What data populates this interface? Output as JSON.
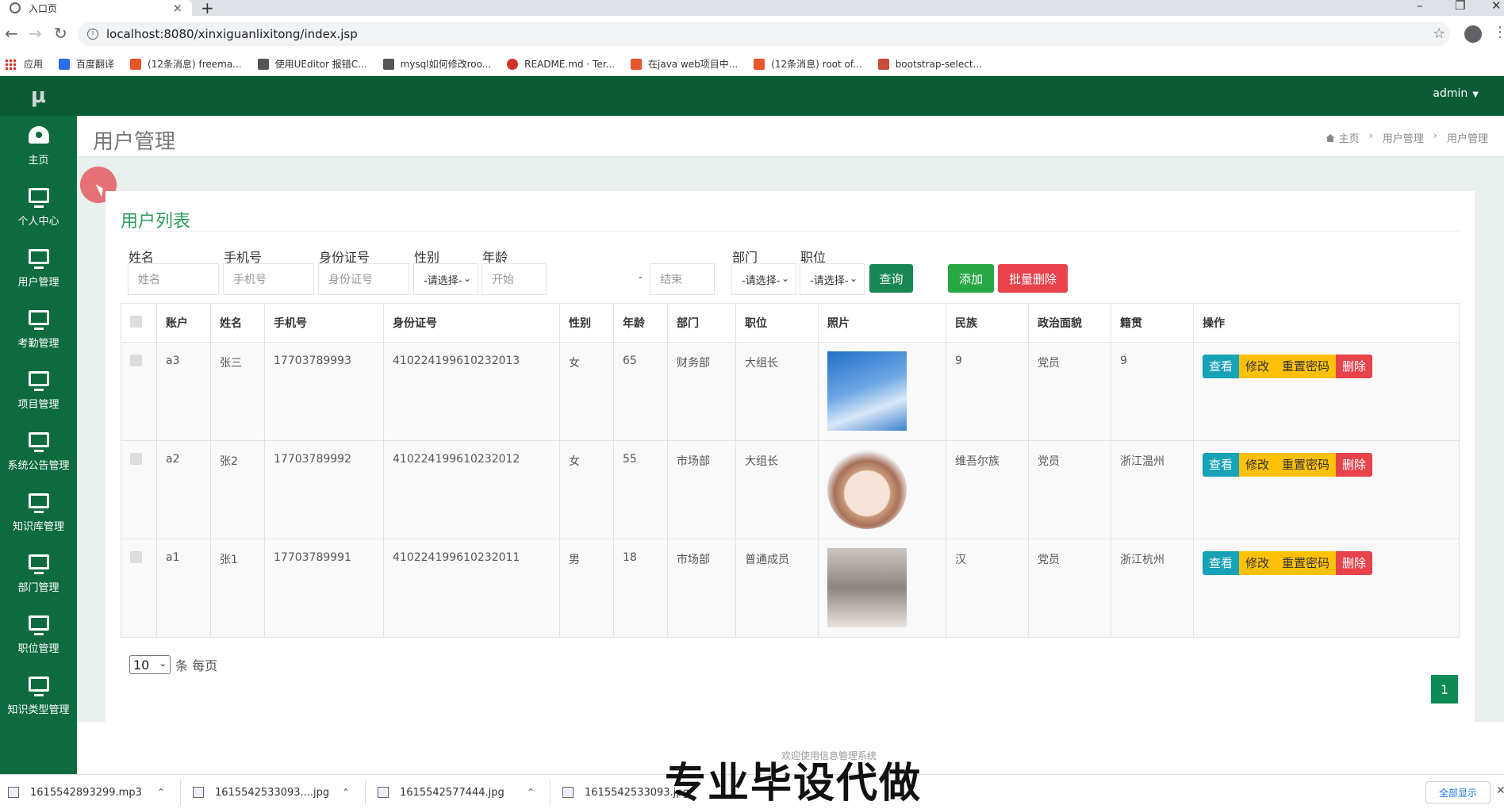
{
  "browser": {
    "tab_title": "入口页",
    "url": "localhost:8080/xinxiguanlixitong/index.jsp",
    "bookmarks": [
      {
        "label": "应用",
        "color": "#d93025"
      },
      {
        "label": "百度翻译",
        "color": "#2b6de8"
      },
      {
        "label": "(12条消息) freema...",
        "color": "#e8542c"
      },
      {
        "label": "使用UEditor 报错C...",
        "color": "#555555"
      },
      {
        "label": "mysql如何修改roo...",
        "color": "#555555"
      },
      {
        "label": "README.md · Ter...",
        "color": "#d0312d"
      },
      {
        "label": "在java web项目中...",
        "color": "#e8542c"
      },
      {
        "label": "(12条消息) root of...",
        "color": "#e8542c"
      },
      {
        "label": "bootstrap-select...",
        "color": "#c94c3a"
      }
    ]
  },
  "app": {
    "brand": "μ",
    "user": "admin",
    "sidebar": [
      {
        "label": "主页",
        "icon": "dashboard-icon"
      },
      {
        "label": "个人中心",
        "icon": "monitor-icon"
      },
      {
        "label": "用户管理",
        "icon": "monitor-icon"
      },
      {
        "label": "考勤管理",
        "icon": "monitor-icon"
      },
      {
        "label": "项目管理",
        "icon": "monitor-icon"
      },
      {
        "label": "系统公告管理",
        "icon": "monitor-icon"
      },
      {
        "label": "知识库管理",
        "icon": "monitor-icon"
      },
      {
        "label": "部门管理",
        "icon": "monitor-icon"
      },
      {
        "label": "职位管理",
        "icon": "monitor-icon"
      },
      {
        "label": "知识类型管理",
        "icon": "monitor-icon"
      }
    ],
    "page_title": "用户管理",
    "breadcrumb": [
      "主页",
      "用户管理",
      "用户管理"
    ],
    "breadcrumb_sep": "›",
    "card_title": "用户列表",
    "filters": {
      "name_label": "姓名",
      "name_placeholder": "姓名",
      "phone_label": "手机号",
      "phone_placeholder": "手机号",
      "idcard_label": "身份证号",
      "idcard_placeholder": "身份证号",
      "gender_label": "性别",
      "gender_value": "-请选择-",
      "age_label": "年龄",
      "age_start_placeholder": "开始",
      "age_end_placeholder": "结束",
      "dept_label": "部门",
      "dept_value": "-请选择-",
      "position_label": "职位",
      "position_value": "-请选择-",
      "dash": "-"
    },
    "buttons": {
      "query": "查询",
      "add": "添加",
      "batch_delete": "批量删除"
    },
    "table": {
      "headers": [
        "账户",
        "姓名",
        "手机号",
        "身份证号",
        "性别",
        "年龄",
        "部门",
        "职位",
        "照片",
        "民族",
        "政治面貌",
        "籍贯",
        "操作"
      ],
      "rows": [
        {
          "account": "a3",
          "name": "张三",
          "phone": "17703789993",
          "idcard": "410224199610232013",
          "gender": "女",
          "age": "65",
          "dept": "财务部",
          "position": "大组长",
          "photo": "photo-boy-sky",
          "ethnicity": "9",
          "politics": "党员",
          "hometown": "9"
        },
        {
          "account": "a2",
          "name": "张2",
          "phone": "17703789992",
          "idcard": "410224199610232012",
          "gender": "女",
          "age": "55",
          "dept": "市场部",
          "position": "大组长",
          "photo": "photo-girl-illustration",
          "ethnicity": "维吾尔族",
          "politics": "党员",
          "hometown": "浙江温州"
        },
        {
          "account": "a1",
          "name": "张1",
          "phone": "17703789991",
          "idcard": "410224199610232011",
          "gender": "男",
          "age": "18",
          "dept": "市场部",
          "position": "普通成员",
          "photo": "photo-man-selfie",
          "ethnicity": "汉",
          "politics": "党员",
          "hometown": "浙江杭州"
        }
      ],
      "actions": {
        "view": "查看",
        "edit": "修改",
        "reset": "重置密码",
        "delete": "删除"
      }
    },
    "pagination": {
      "page_size": "10",
      "per_page_text": "条 每页",
      "current_page": "1"
    },
    "footer_text": "欢迎使用信息管理系统"
  },
  "downloads": {
    "items": [
      "1615542893299.mp3",
      "1615542533093....jpg",
      "1615542577444.jpg",
      "1615542533093.jpg"
    ],
    "show_all": "全部显示"
  },
  "overlay_watermark": "专业毕设代做"
}
